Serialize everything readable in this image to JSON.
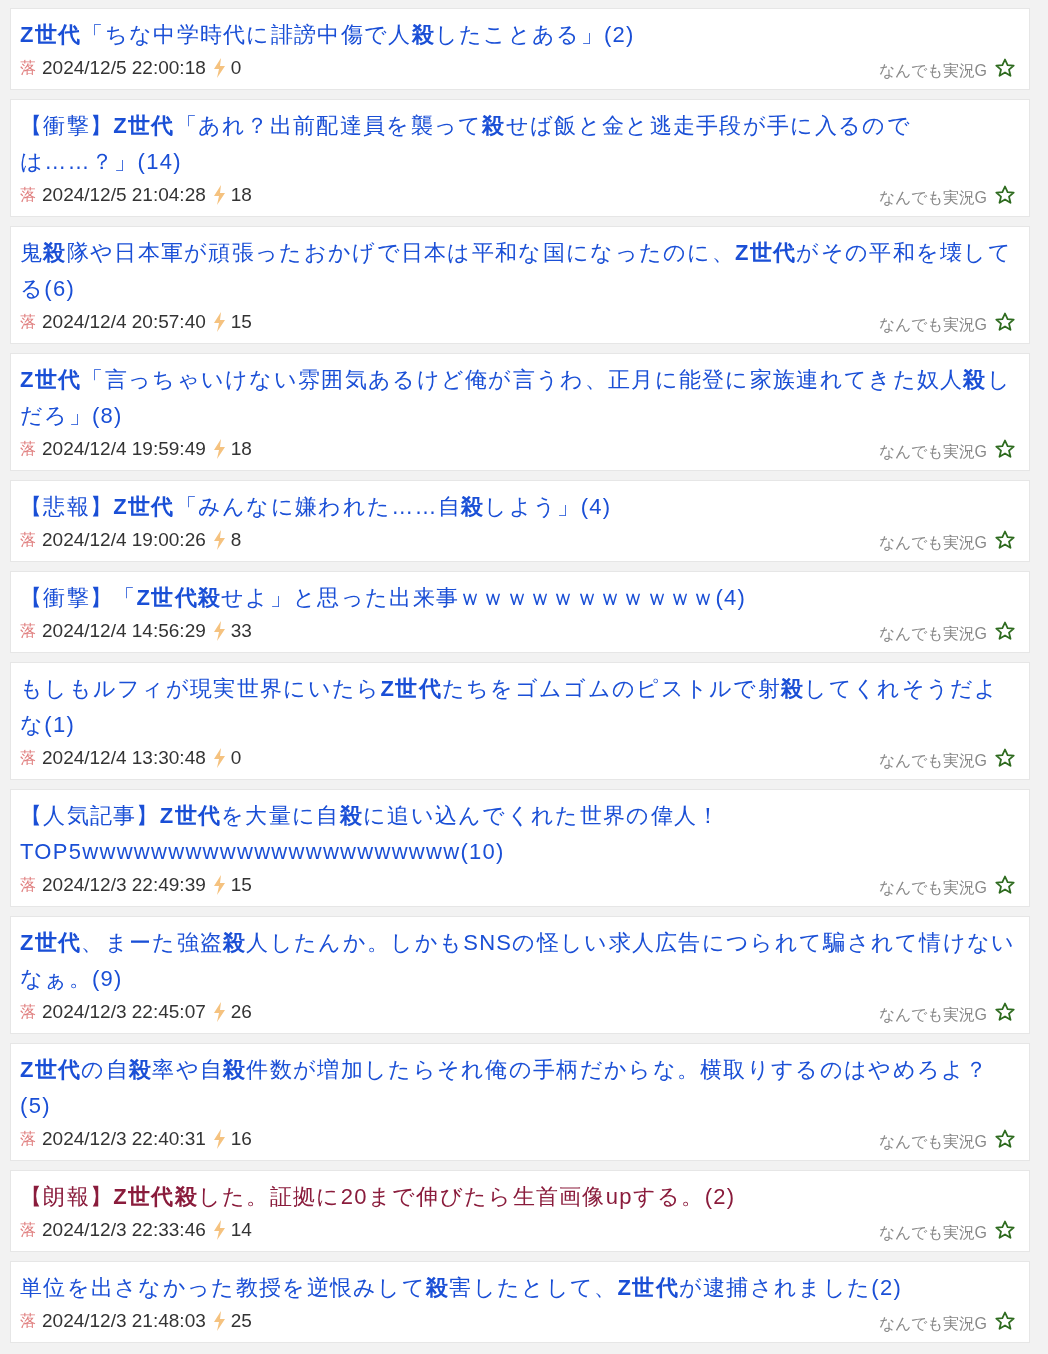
{
  "items": [
    {
      "title": "**Z世代**「ちな中学時代に誹謗中傷で人**殺**したことある」(2)",
      "visited": false,
      "badge": "落",
      "date": "2024/12/5 22:00:18",
      "count": "0",
      "source": "なんでも実況G"
    },
    {
      "title": "【衝撃】**Z世代**「あれ？出前配達員を襲って**殺**せば飯と金と逃走手段が手に入るのでは……？」(14)",
      "visited": false,
      "badge": "落",
      "date": "2024/12/5 21:04:28",
      "count": "18",
      "source": "なんでも実況G"
    },
    {
      "title": "鬼**殺**隊や日本軍が頑張ったおかげで日本は平和な国になったのに、**Z世代**がその平和を壊してる(6)",
      "visited": false,
      "badge": "落",
      "date": "2024/12/4 20:57:40",
      "count": "15",
      "source": "なんでも実況G"
    },
    {
      "title": "**Z世代**「言っちゃいけない雰囲気あるけど俺が言うわ、正月に能登に家族連れてきた奴人**殺**しだろ」(8)",
      "visited": false,
      "badge": "落",
      "date": "2024/12/4 19:59:49",
      "count": "18",
      "source": "なんでも実況G"
    },
    {
      "title": "【悲報】**Z世代**「みんなに嫌われた……自**殺**しよう」(4)",
      "visited": false,
      "badge": "落",
      "date": "2024/12/4 19:00:26",
      "count": "8",
      "source": "なんでも実況G"
    },
    {
      "title": "【衝撃】「**Z世代殺**せよ」と思った出来事ｗｗｗｗｗｗｗｗｗｗｗ(4)",
      "visited": false,
      "badge": "落",
      "date": "2024/12/4 14:56:29",
      "count": "33",
      "source": "なんでも実況G"
    },
    {
      "title": "もしもルフィが現実世界にいたら**Z世代**たちをゴムゴムのピストルで射**殺**してくれそうだよな(1)",
      "visited": false,
      "badge": "落",
      "date": "2024/12/4 13:30:48",
      "count": "0",
      "source": "なんでも実況G"
    },
    {
      "title": "【人気記事】**Z世代**を大量に自**殺**に追い込んでくれた世界の偉人！TOP5wwwwwwwwwwwwwwwwwwwwww(10)",
      "visited": false,
      "badge": "落",
      "date": "2024/12/3 22:49:39",
      "count": "15",
      "source": "なんでも実況G"
    },
    {
      "title": "**Z世代**、まーた強盗**殺**人したんか。しかもSNSの怪しい求人広告につられて騙されて情けないなぁ。(9)",
      "visited": false,
      "badge": "落",
      "date": "2024/12/3 22:45:07",
      "count": "26",
      "source": "なんでも実況G"
    },
    {
      "title": "**Z世代**の自**殺**率や自**殺**件数が増加したらそれ俺の手柄だからな。横取りするのはやめろよ？(5)",
      "visited": false,
      "badge": "落",
      "date": "2024/12/3 22:40:31",
      "count": "16",
      "source": "なんでも実況G"
    },
    {
      "title": "【朗報】**Z世代殺**した。証拠に20まで伸びたら生首画像upする。(2)",
      "visited": true,
      "badge": "落",
      "date": "2024/12/3 22:33:46",
      "count": "14",
      "source": "なんでも実況G"
    },
    {
      "title": "単位を出さなかった教授を逆恨みして**殺**害したとして、**Z世代**が逮捕されました(2)",
      "visited": false,
      "badge": "落",
      "date": "2024/12/3 21:48:03",
      "count": "25",
      "source": "なんでも実況G"
    }
  ]
}
